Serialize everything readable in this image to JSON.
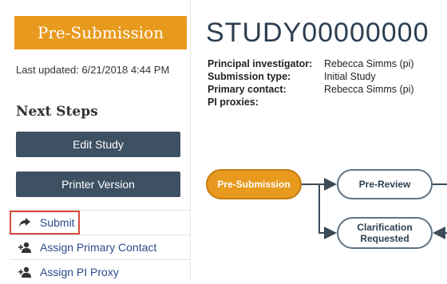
{
  "left": {
    "status_banner": "Pre-Submission",
    "last_updated_label": "Last updated:",
    "last_updated_value": "6/21/2018 4:44 PM",
    "next_steps_heading": "Next Steps",
    "buttons": {
      "edit_study": "Edit Study",
      "printer_version": "Printer Version"
    },
    "actions": [
      {
        "label": "Submit",
        "icon": "share-arrow-icon"
      },
      {
        "label": "Assign Primary Contact",
        "icon": "add-user-icon"
      },
      {
        "label": "Assign PI Proxy",
        "icon": "add-user-icon"
      }
    ]
  },
  "study": {
    "id": "STUDY00000000",
    "fields": [
      {
        "label": "Principal investigator:",
        "value": "Rebecca Simms (pi)"
      },
      {
        "label": "Submission type:",
        "value": "Initial Study"
      },
      {
        "label": "Primary contact:",
        "value": "Rebecca Simms (pi)"
      },
      {
        "label": "PI proxies:",
        "value": ""
      }
    ]
  },
  "workflow": {
    "nodes": [
      "Pre-Submission",
      "Pre-Review",
      "Clarification Requested"
    ]
  },
  "colors": {
    "accent_orange": "#e89a1e",
    "button_slate": "#3d5163",
    "link_blue": "#2b4a8b",
    "highlight_red": "#d94b3c"
  }
}
